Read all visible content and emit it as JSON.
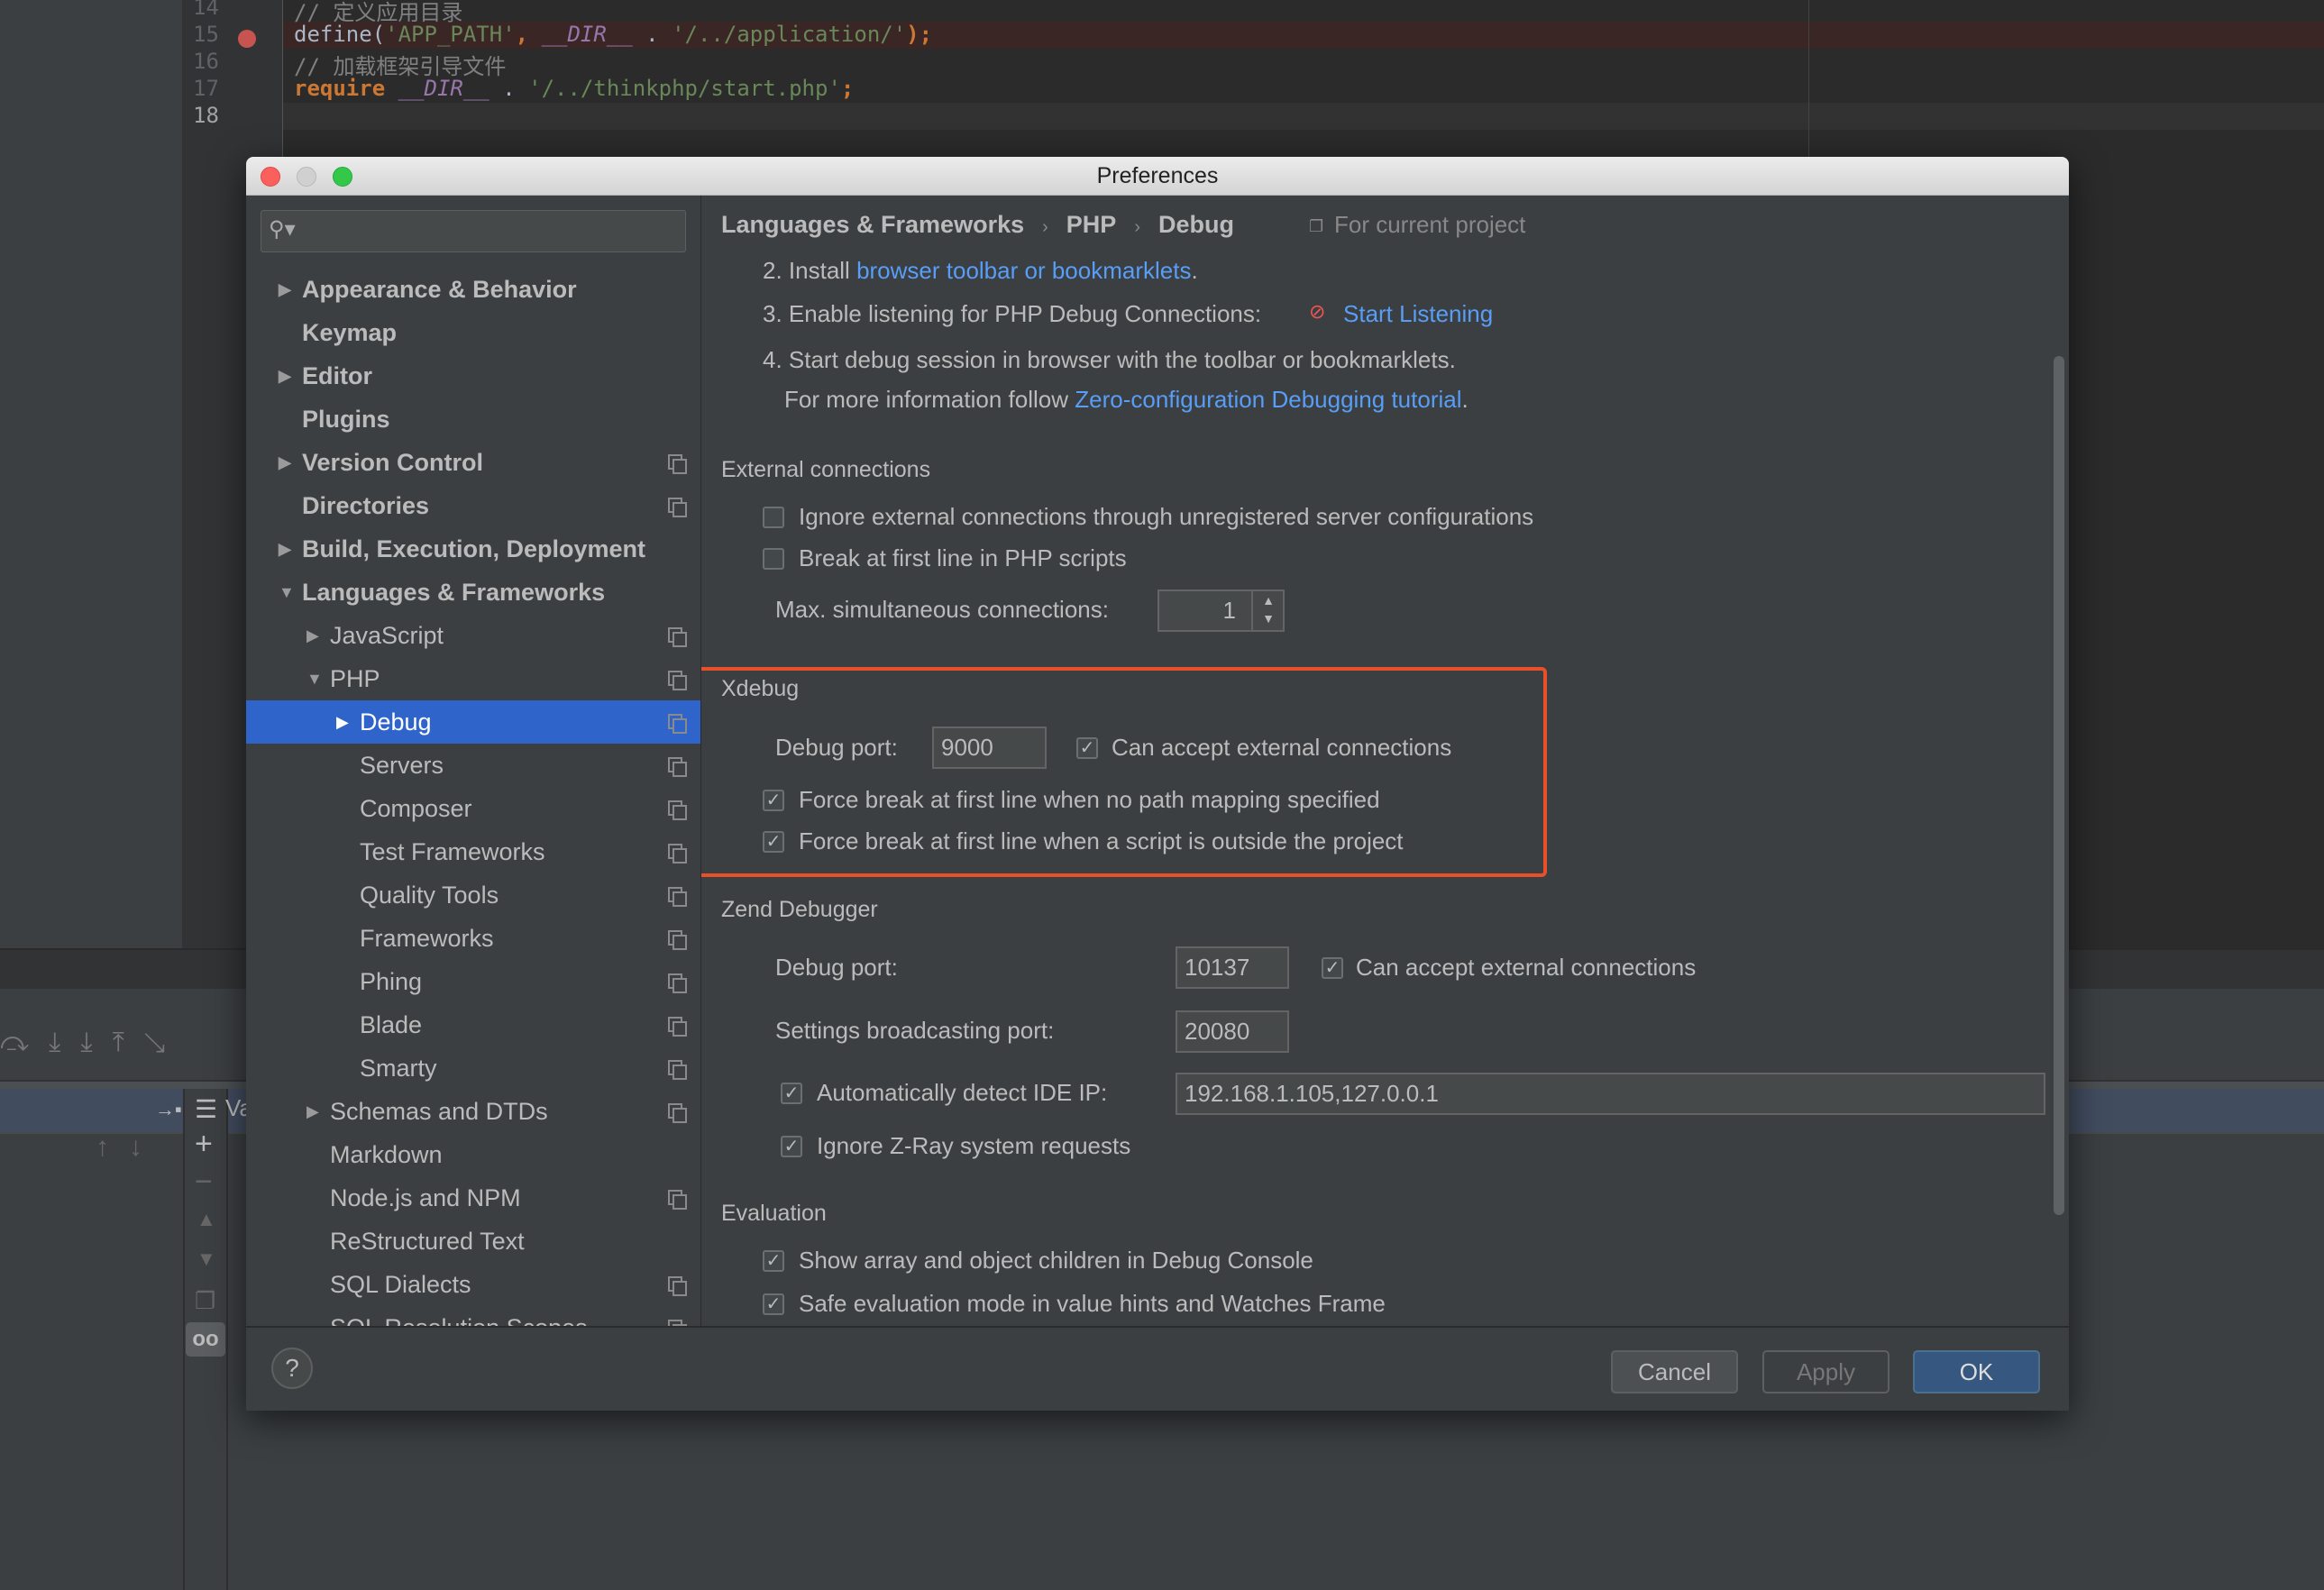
{
  "editor": {
    "lines": [
      {
        "num": "14",
        "html": "// 定义应用目录",
        "type": "comment"
      },
      {
        "num": "15",
        "parts": [
          "define(",
          "'APP_PATH'",
          ", ",
          "__DIR__",
          " . ",
          "'/../application/'",
          ");"
        ],
        "breakpoint": true
      },
      {
        "num": "16",
        "html": "// 加载框架引导文件",
        "type": "comment"
      },
      {
        "num": "17",
        "parts": [
          "require",
          " ",
          "__DIR__",
          " . ",
          "'/../thinkphp/start.php'",
          ";"
        ]
      },
      {
        "num": "18"
      }
    ],
    "debug_panel_label": "Va"
  },
  "dialog": {
    "title": "Preferences",
    "sidebar": {
      "search_placeholder": "",
      "items": [
        {
          "label": "Appearance & Behavior",
          "level": 0,
          "arrow": "right",
          "bold": true
        },
        {
          "label": "Keymap",
          "level": 0,
          "bold": true
        },
        {
          "label": "Editor",
          "level": 0,
          "arrow": "right",
          "bold": true
        },
        {
          "label": "Plugins",
          "level": 0,
          "bold": true
        },
        {
          "label": "Version Control",
          "level": 0,
          "arrow": "right",
          "bold": true,
          "project": true
        },
        {
          "label": "Directories",
          "level": 0,
          "bold": true,
          "project": true
        },
        {
          "label": "Build, Execution, Deployment",
          "level": 0,
          "arrow": "right",
          "bold": true
        },
        {
          "label": "Languages & Frameworks",
          "level": 0,
          "arrow": "down",
          "bold": true
        },
        {
          "label": "JavaScript",
          "level": 1,
          "arrow": "right",
          "project": true
        },
        {
          "label": "PHP",
          "level": 1,
          "arrow": "down",
          "project": true
        },
        {
          "label": "Debug",
          "level": 2,
          "arrow": "right",
          "project": true,
          "selected": true
        },
        {
          "label": "Servers",
          "level": 2,
          "project": true
        },
        {
          "label": "Composer",
          "level": 2,
          "project": true
        },
        {
          "label": "Test Frameworks",
          "level": 2,
          "project": true
        },
        {
          "label": "Quality Tools",
          "level": 2,
          "project": true
        },
        {
          "label": "Frameworks",
          "level": 2,
          "project": true
        },
        {
          "label": "Phing",
          "level": 2,
          "project": true
        },
        {
          "label": "Blade",
          "level": 2,
          "project": true
        },
        {
          "label": "Smarty",
          "level": 2,
          "project": true
        },
        {
          "label": "Schemas and DTDs",
          "level": 1,
          "arrow": "right",
          "project": true
        },
        {
          "label": "Markdown",
          "level": 1
        },
        {
          "label": "Node.js and NPM",
          "level": 1,
          "project": true
        },
        {
          "label": "ReStructured Text",
          "level": 1
        },
        {
          "label": "SQL Dialects",
          "level": 1,
          "project": true
        },
        {
          "label": "SQL Resolution Scopes",
          "level": 1,
          "project": true
        }
      ]
    },
    "breadcrumb": [
      "Languages & Frameworks",
      "PHP",
      "Debug"
    ],
    "scope": "For current project",
    "steps": {
      "s2_prefix": "2. Install ",
      "s2_link": "browser toolbar or bookmarklets",
      "s2_suffix": ".",
      "s3_prefix": "3. Enable listening for PHP Debug Connections:",
      "s3_link": "Start Listening",
      "s4": "4. Start debug session in browser with the toolbar or bookmarklets.",
      "info_prefix": "For more information follow ",
      "info_link": "Zero-configuration Debugging tutorial",
      "info_suffix": "."
    },
    "external": {
      "title": "External connections",
      "ignore_label": "Ignore external connections through unregistered server configurations",
      "ignore_checked": false,
      "break_label": "Break at first line in PHP scripts",
      "break_checked": false,
      "max_label": "Max. simultaneous connections:",
      "max_value": "1"
    },
    "xdebug": {
      "title": "Xdebug",
      "port_label": "Debug port:",
      "port": "9000",
      "accept_label": "Can accept external connections",
      "accept_checked": true,
      "force1_label": "Force break at first line when no path mapping specified",
      "force1_checked": true,
      "force2_label": "Force break at first line when a script is outside the project",
      "force2_checked": true,
      "highlight_color": "#e8502a"
    },
    "zend": {
      "title": "Zend Debugger",
      "port_label": "Debug port:",
      "port": "10137",
      "accept_label": "Can accept external connections",
      "accept_checked": true,
      "bcast_label": "Settings broadcasting port:",
      "bcast_port": "20080",
      "auto_label": "Automatically detect IDE IP:",
      "auto_checked": true,
      "ip": "192.168.1.105,127.0.0.1",
      "zray_label": "Ignore Z-Ray system requests",
      "zray_checked": true
    },
    "evaluation": {
      "title": "Evaluation",
      "show_label": "Show array and object children in Debug Console",
      "show_checked": true,
      "safe_label": "Safe evaluation mode in value hints and Watches Frame",
      "safe_checked": true
    },
    "buttons": {
      "help": "?",
      "cancel": "Cancel",
      "apply": "Apply",
      "ok": "OK"
    },
    "colors": {
      "selection": "#2f65ca",
      "link": "#589df6",
      "ok": "#365880"
    }
  }
}
